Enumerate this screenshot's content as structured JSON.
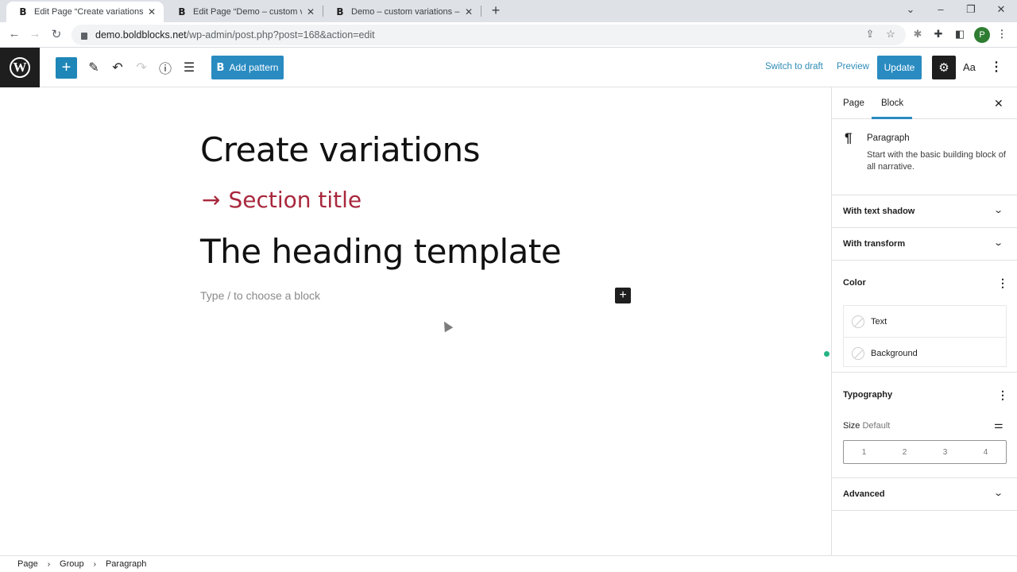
{
  "browser": {
    "tabs": [
      {
        "favicon": "B",
        "title": "Edit Page “Create variations” ‹ Bo",
        "active": true
      },
      {
        "favicon": "B",
        "title": "Edit Page “Demo – custom variati",
        "active": false
      },
      {
        "favicon": "B",
        "title": "Demo – custom variations – Bold",
        "active": false
      }
    ],
    "new_tab": "+",
    "url_host": "demo.boldblocks.net",
    "url_path": "/wp-admin/post.php?post=168&action=edit",
    "profile_initial": "P",
    "window_controls": {
      "dropdown": "⌄",
      "minimize": "–",
      "restore": "❐",
      "close": "✕"
    },
    "nav": {
      "back": "←",
      "forward": "→",
      "reload": "↻"
    }
  },
  "editor_header": {
    "inserter_icon": "+",
    "add_pattern_label": "Add pattern",
    "add_pattern_icon": "B",
    "switch_to_draft": "Switch to draft",
    "preview": "Preview",
    "update": "Update",
    "styles_label": "Aa"
  },
  "content": {
    "heading1": "Create variations",
    "section_arrow": "→",
    "section_title": "Section title",
    "heading2": "The heading template",
    "placeholder": "Type / to choose a block",
    "block_inserter": "+"
  },
  "sidebar": {
    "tabs": [
      {
        "label": "Page",
        "active": false
      },
      {
        "label": "Block",
        "active": true
      }
    ],
    "close": "✕",
    "block": {
      "name": "Paragraph",
      "description": "Start with the basic building block of all narrative."
    },
    "panels": [
      {
        "title": "With text shadow"
      },
      {
        "title": "With transform"
      }
    ],
    "color": {
      "title": "Color",
      "items": [
        {
          "label": "Text"
        },
        {
          "label": "Background"
        }
      ]
    },
    "typography": {
      "title": "Typography",
      "size_label": "Size",
      "size_value": "Default",
      "size_options": [
        "1",
        "2",
        "3",
        "4"
      ]
    },
    "advanced": {
      "title": "Advanced"
    }
  },
  "breadcrumb": [
    "Page",
    "Group",
    "Paragraph"
  ],
  "colors": {
    "accent": "#2a8bc1",
    "section_title": "#a8283d",
    "status_dot": "#26b383"
  }
}
